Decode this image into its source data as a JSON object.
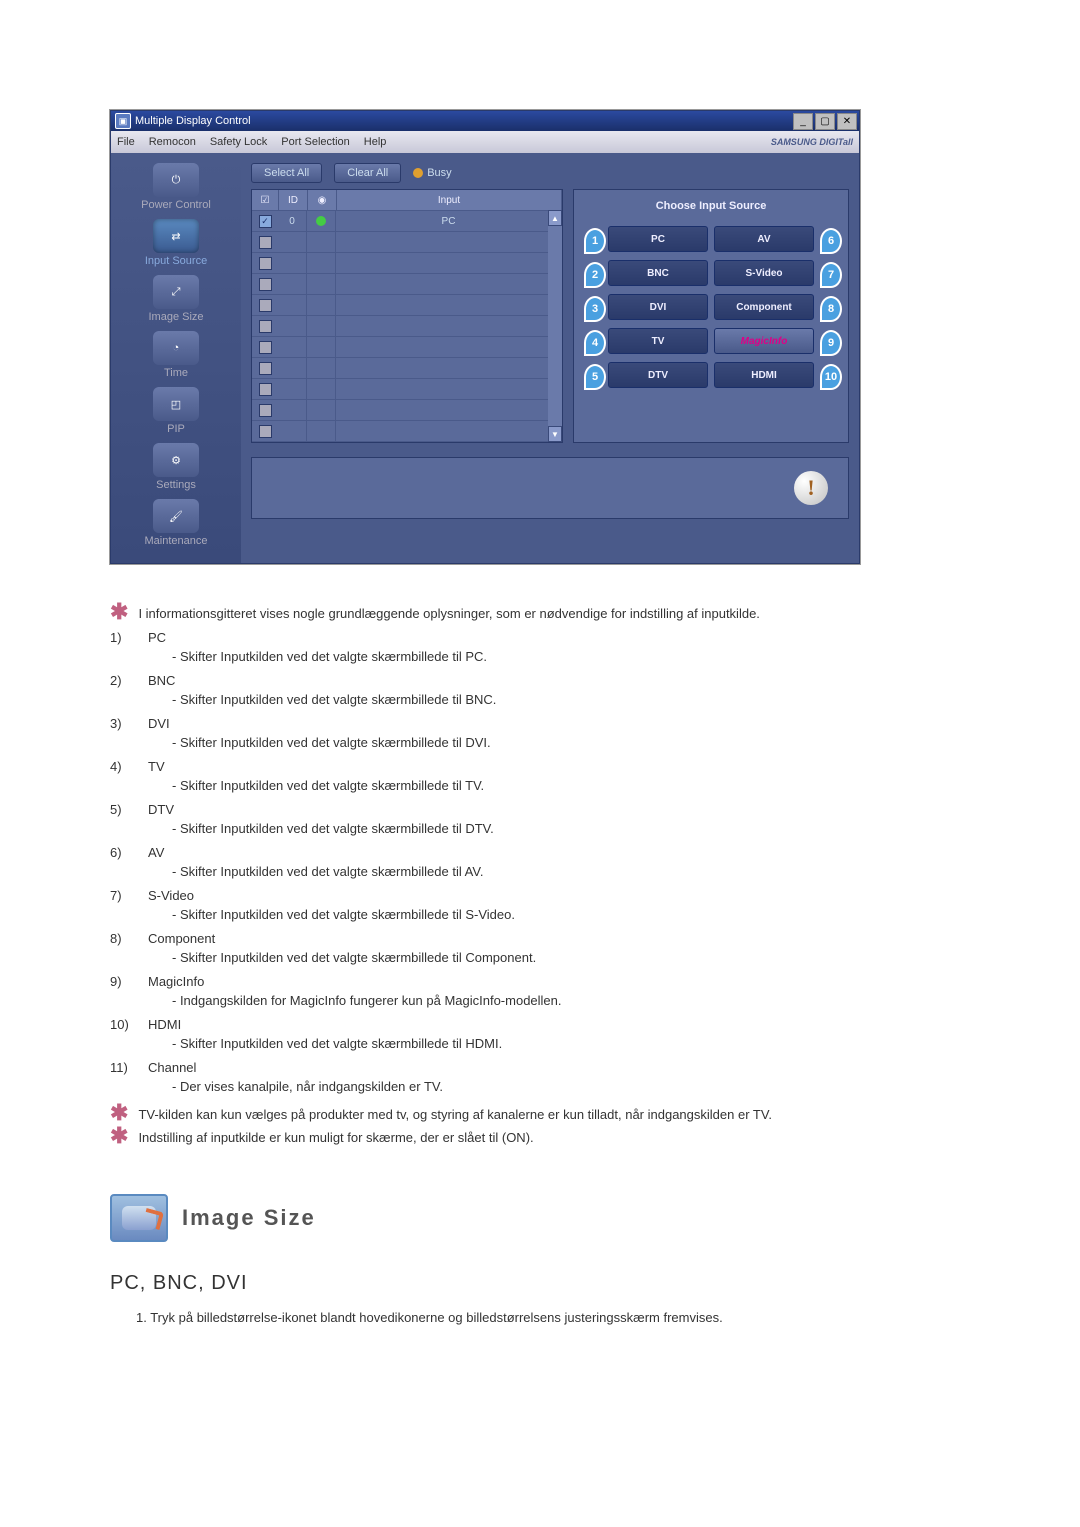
{
  "app": {
    "title": "Multiple Display Control",
    "menus": [
      "File",
      "Remocon",
      "Safety Lock",
      "Port Selection",
      "Help"
    ],
    "brand": "SAMSUNG DIGITall"
  },
  "sidebar": [
    {
      "label": "Power Control"
    },
    {
      "label": "Input Source"
    },
    {
      "label": "Image Size"
    },
    {
      "label": "Time"
    },
    {
      "label": "PIP"
    },
    {
      "label": "Settings"
    },
    {
      "label": "Maintenance"
    }
  ],
  "toolbar": {
    "select_all": "Select All",
    "clear_all": "Clear All",
    "busy": "Busy"
  },
  "grid": {
    "headers": {
      "c2": "ID",
      "c4": "Input"
    },
    "first_row": {
      "id": "0",
      "input": "PC"
    }
  },
  "panel": {
    "title": "Choose Input Source",
    "left": [
      {
        "n": "1",
        "label": "PC"
      },
      {
        "n": "2",
        "label": "BNC"
      },
      {
        "n": "3",
        "label": "DVI"
      },
      {
        "n": "4",
        "label": "TV"
      },
      {
        "n": "5",
        "label": "DTV"
      }
    ],
    "right": [
      {
        "n": "6",
        "label": "AV"
      },
      {
        "n": "7",
        "label": "S-Video"
      },
      {
        "n": "8",
        "label": "Component"
      },
      {
        "n": "9",
        "label": "MagicInfo"
      },
      {
        "n": "10",
        "label": "HDMI"
      }
    ]
  },
  "doc": {
    "star1": "I informationsgitteret vises nogle grundlæggende oplysninger, som er nødvendige for indstilling af inputkilde.",
    "items": [
      {
        "n": "1)",
        "t": "PC",
        "d": "- Skifter Inputkilden ved det valgte skærmbillede til PC."
      },
      {
        "n": "2)",
        "t": "BNC",
        "d": "- Skifter Inputkilden ved det valgte skærmbillede til BNC."
      },
      {
        "n": "3)",
        "t": "DVI",
        "d": "- Skifter Inputkilden ved det valgte skærmbillede til DVI."
      },
      {
        "n": "4)",
        "t": "TV",
        "d": "- Skifter Inputkilden ved det valgte skærmbillede til TV."
      },
      {
        "n": "5)",
        "t": "DTV",
        "d": "- Skifter Inputkilden ved det valgte skærmbillede til DTV."
      },
      {
        "n": "6)",
        "t": "AV",
        "d": "- Skifter Inputkilden ved det valgte skærmbillede til AV."
      },
      {
        "n": "7)",
        "t": "S-Video",
        "d": "- Skifter Inputkilden ved det valgte skærmbillede til S-Video."
      },
      {
        "n": "8)",
        "t": "Component",
        "d": "- Skifter Inputkilden ved det valgte skærmbillede til Component."
      },
      {
        "n": "9)",
        "t": "MagicInfo",
        "d": "- Indgangskilden for MagicInfo fungerer kun på MagicInfo-modellen."
      },
      {
        "n": "10)",
        "t": "HDMI",
        "d": "- Skifter Inputkilden ved det valgte skærmbillede til HDMI."
      },
      {
        "n": "11)",
        "t": "Channel",
        "d": "- Der vises kanalpile, når indgangskilden er TV."
      }
    ],
    "star2": "TV-kilden kan kun vælges på produkter med tv, og styring af kanalerne er kun tilladt, når indgangskilden er TV.",
    "star3": "Indstilling af inputkilde er kun muligt for skærme, der er slået til (ON).",
    "section_title": "Image Size",
    "subsection": "PC, BNC, DVI",
    "body": "1. Tryk på billedstørrelse-ikonet blandt hovedikonerne og billedstørrelsens justeringsskærm fremvises."
  }
}
